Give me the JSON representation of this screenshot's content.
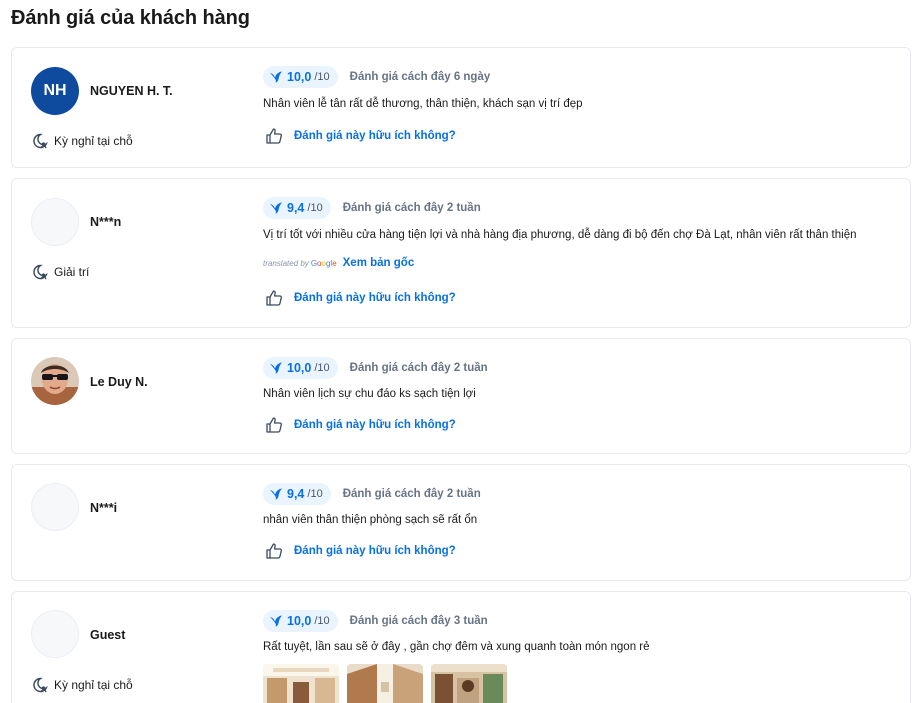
{
  "page": {
    "title": "Đánh giá của khách hàng"
  },
  "colors": {
    "accent": "#0770e3",
    "pill_bg": "#eaf4ff",
    "avatar_blue": "#0e4a9e"
  },
  "helpful_label": "Đánh giá này hữu ích không?",
  "reviews": [
    {
      "avatar_initials": "NH",
      "name": "NGUYEN H. T.",
      "trip_type": "Kỳ nghỉ tại chỗ",
      "score": "10,0",
      "score_max": "/10",
      "date": "Đánh giá cách đây 6 ngày",
      "text": "Nhân viên lễ tân rất dễ thương, thân thiện, khách sạn vị trí đẹp"
    },
    {
      "name": "N***n",
      "trip_type": "Giải trí",
      "score": "9,4",
      "score_max": "/10",
      "date": "Đánh giá cách đây 2 tuần",
      "text": "Vị trí tốt với nhiều cửa hàng tiện lợi và nhà hàng địa phương, dễ dàng đi bộ đến chợ Đà Lạt, nhân viên rất thân thiện",
      "translated_by": "translated by",
      "translator": "Google",
      "see_original": "Xem bản gốc"
    },
    {
      "name": "Le Duy N.",
      "score": "10,0",
      "score_max": "/10",
      "date": "Đánh giá cách đây 2 tuần",
      "text": "Nhân viên lịch sự chu đáo ks sạch tiện lợi"
    },
    {
      "name": "N***i",
      "score": "9,4",
      "score_max": "/10",
      "date": "Đánh giá cách đây 2 tuần",
      "text": "nhân viên thân thiện phòng sạch sẽ rất ổn"
    },
    {
      "name": "Guest",
      "trip_type": "Kỳ nghỉ tại chỗ",
      "score": "10,0",
      "score_max": "/10",
      "date": "Đánh giá cách đây 3 tuần",
      "text": "Rất tuyệt, lần sau sẽ ở đây , gần chợ đêm và xung quanh toàn món ngon rẻ"
    }
  ]
}
